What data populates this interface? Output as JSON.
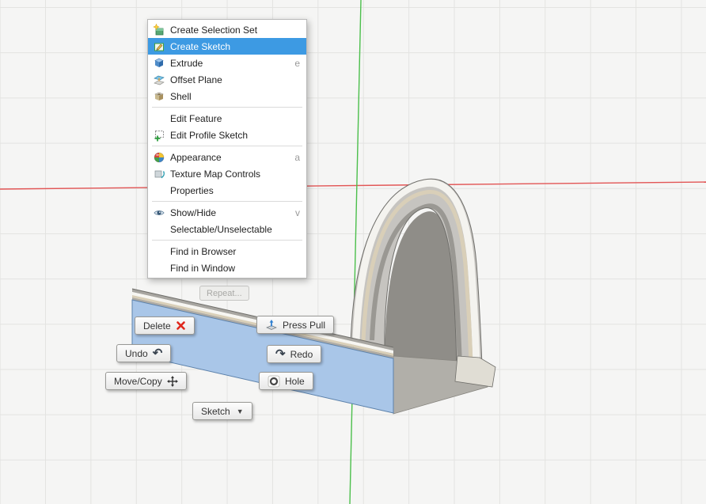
{
  "viewport": {
    "background_color": "#f5f5f4",
    "grid_line_color": "#e3e3e1",
    "x_axis_color": "#e25555",
    "y_axis_color": "#4bbf4b"
  },
  "model": {
    "selected_face_color": "#a9c6e8",
    "selected_face_border": "#5d82ab"
  },
  "icons": {
    "dropdown_arrow": "▼",
    "undo_arrow": "↶",
    "redo_arrow": "↷"
  },
  "context_menu": {
    "highlight_color": "#3d9ae3",
    "items": [
      {
        "label": "Create Selection Set",
        "icon": "selection-set-icon"
      },
      {
        "label": "Create Sketch",
        "icon": "create-sketch-icon",
        "highlighted": true
      },
      {
        "label": "Extrude",
        "icon": "extrude-icon",
        "shortcut": "e"
      },
      {
        "label": "Offset Plane",
        "icon": "offset-plane-icon"
      },
      {
        "label": "Shell",
        "icon": "shell-icon"
      },
      {
        "label": "Edit Feature"
      },
      {
        "label": "Edit Profile Sketch",
        "icon": "edit-profile-sketch-icon"
      },
      {
        "label": "Appearance",
        "icon": "appearance-icon",
        "shortcut": "a"
      },
      {
        "label": "Texture Map Controls",
        "icon": "texture-map-icon"
      },
      {
        "label": "Properties"
      },
      {
        "label": "Show/Hide",
        "icon": "show-hide-icon",
        "shortcut": "v"
      },
      {
        "label": "Selectable/Unselectable"
      },
      {
        "label": "Find in Browser"
      },
      {
        "label": "Find in Window"
      }
    ]
  },
  "marking_menu": {
    "repeat": {
      "label": "Repeat...",
      "disabled": true
    },
    "delete": {
      "label": "Delete",
      "icon": "red-x-icon"
    },
    "press_pull": {
      "label": "Press Pull",
      "icon": "press-pull-icon"
    },
    "undo": {
      "label": "Undo",
      "icon": "undo-arrow-icon"
    },
    "redo": {
      "label": "Redo",
      "icon": "redo-arrow-icon"
    },
    "move_copy": {
      "label": "Move/Copy",
      "icon": "move-cross-icon"
    },
    "hole": {
      "label": "Hole",
      "icon": "hole-icon"
    },
    "sketch": {
      "label": "Sketch",
      "icon": "dropdown-arrow-icon"
    }
  }
}
